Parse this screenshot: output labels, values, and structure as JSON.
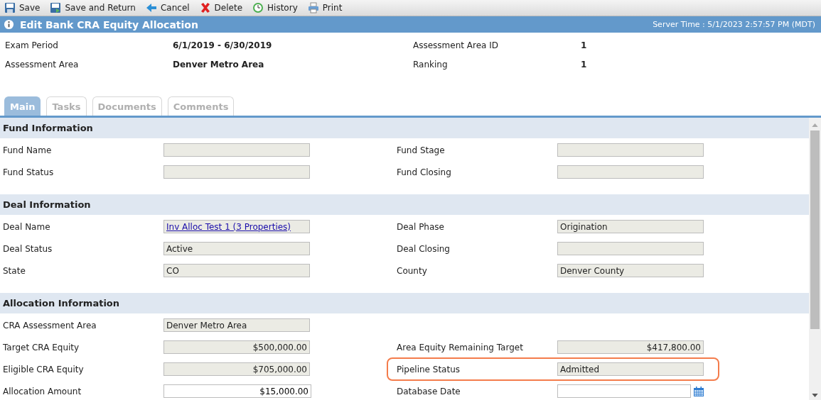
{
  "toolbar": [
    {
      "label": "Save",
      "kind": "save"
    },
    {
      "label": "Save and Return",
      "kind": "save_return"
    },
    {
      "label": "Cancel",
      "kind": "cancel"
    },
    {
      "label": "Delete",
      "kind": "delete"
    },
    {
      "label": "History",
      "kind": "history"
    },
    {
      "label": "Print",
      "kind": "print"
    }
  ],
  "title": "Edit Bank CRA Equity Allocation",
  "server_time": "Server Time : 5/1/2023 2:57:57 PM (MDT)",
  "summary": [
    {
      "label": "Exam Period",
      "value": "6/1/2019 - 6/30/2019",
      "label2": "Assessment Area ID",
      "value2": "1"
    },
    {
      "label": "Assessment Area",
      "value": "Denver Metro Area",
      "label2": "Ranking",
      "value2": "1"
    }
  ],
  "tabs": [
    {
      "label": "Main",
      "selected": true
    },
    {
      "label": "Tasks",
      "selected": false
    },
    {
      "label": "Documents",
      "selected": false
    },
    {
      "label": "Comments",
      "selected": false
    }
  ],
  "sections": [
    {
      "title": "Fund Information",
      "rows": [
        [
          {
            "label": "Fund Name",
            "kind": "text"
          },
          {
            "label": "Fund Stage",
            "kind": "text"
          }
        ],
        [
          {
            "label": "Fund Status",
            "kind": "text"
          },
          {
            "label": "Fund Closing",
            "kind": "text"
          }
        ]
      ]
    },
    {
      "title": "Deal Information",
      "rows": [
        [
          {
            "label": "Deal Name",
            "kind": "link",
            "value": "Inv Alloc Test 1 (3 Properties)"
          },
          {
            "label": "Deal Phase",
            "kind": "text",
            "value": "Origination"
          }
        ],
        [
          {
            "label": "Deal Status",
            "kind": "text",
            "value": "Active"
          },
          {
            "label": "Deal Closing",
            "kind": "text"
          }
        ],
        [
          {
            "label": "State",
            "kind": "text",
            "value": "CO"
          },
          {
            "label": "County",
            "kind": "text",
            "value": "Denver County"
          }
        ]
      ]
    },
    {
      "title": "Allocation Information",
      "rows": [
        [
          {
            "label": "CRA Assessment Area",
            "kind": "text",
            "value": "Denver Metro Area"
          }
        ],
        [
          {
            "label": "Target CRA Equity",
            "kind": "amount",
            "value": "$500,000.00"
          },
          {
            "label": "Area Equity Remaining Target",
            "kind": "amount",
            "value": "$417,800.00"
          }
        ],
        [
          {
            "label": "Eligible CRA Equity",
            "kind": "amount",
            "value": "$705,000.00"
          },
          {
            "label": "Pipeline Status",
            "kind": "text",
            "value": "Admitted",
            "highlighted": true
          }
        ],
        [
          {
            "label": "Allocation Amount",
            "kind": "input_amount",
            "value": "$15,000.00"
          },
          {
            "label": "Database Date",
            "kind": "date"
          }
        ]
      ]
    }
  ]
}
